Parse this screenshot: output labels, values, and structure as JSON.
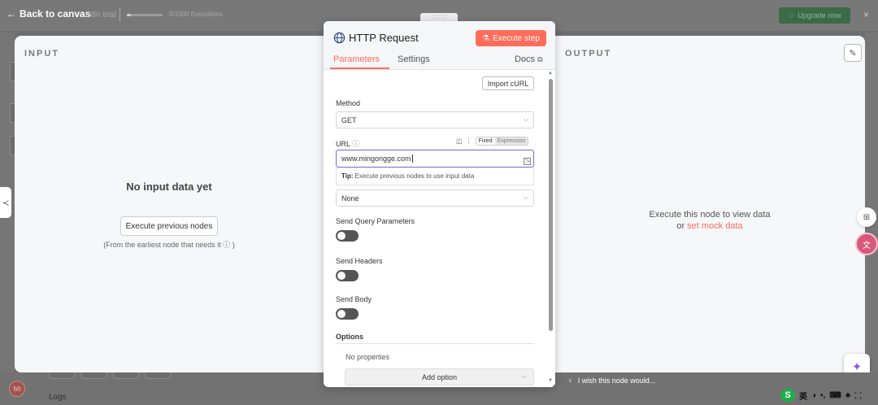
{
  "topbar": {
    "back_label": "Back to canvas",
    "back_icon": "arrow-left-icon",
    "trial_text": "n8n trial",
    "executions_text": "0/1000 Executions",
    "executions_fraction": 0.0,
    "upgrade_label": "Upgrade now",
    "close_glyph": "×",
    "drag_glyph": "::::::"
  },
  "input_panel": {
    "heading": "INPUT",
    "empty_title": "No input data yet",
    "execute_button": "Execute previous nodes",
    "hint": "(From the earliest node that needs it ⓘ )"
  },
  "output_panel": {
    "heading": "OUTPUT",
    "line1": "Execute this node to view data",
    "line2_prefix": "or ",
    "mock_link": "set mock data"
  },
  "dialog": {
    "title": "HTTP Request",
    "execute_button": "Execute step",
    "tabs": {
      "parameters": "Parameters",
      "settings": "Settings",
      "docs": "Docs"
    },
    "import_button": "Import cURL",
    "method_label": "Method",
    "method_value": "GET",
    "url_label": "URL",
    "url_mode_fixed": "Fixed",
    "url_mode_expression": "Expression",
    "url_value": "www.mingongge.com",
    "tip_label": "Tip:",
    "tip_text": "Execute previous nodes to use input data",
    "auth_value": "None",
    "query_params_label": "Send Query Parameters",
    "query_params_enabled": false,
    "headers_label": "Send Headers",
    "headers_enabled": false,
    "body_label": "Send Body",
    "body_enabled": false,
    "options_label": "Options",
    "no_properties": "No properties",
    "add_option": "Add option"
  },
  "bottom": {
    "avatar_initials": "MI",
    "logs_label": "Logs",
    "wish_text": "I wish this node would...",
    "ime_logo": "S",
    "ime_items": [
      "英",
      "◑",
      "•,",
      "⌨",
      "♣",
      "⸬"
    ]
  },
  "colors": {
    "accent": "#ff6d5a",
    "upgrade_green": "#3b6b46",
    "toggle_off": "#555555",
    "url_focus": "#6b6bd6"
  }
}
